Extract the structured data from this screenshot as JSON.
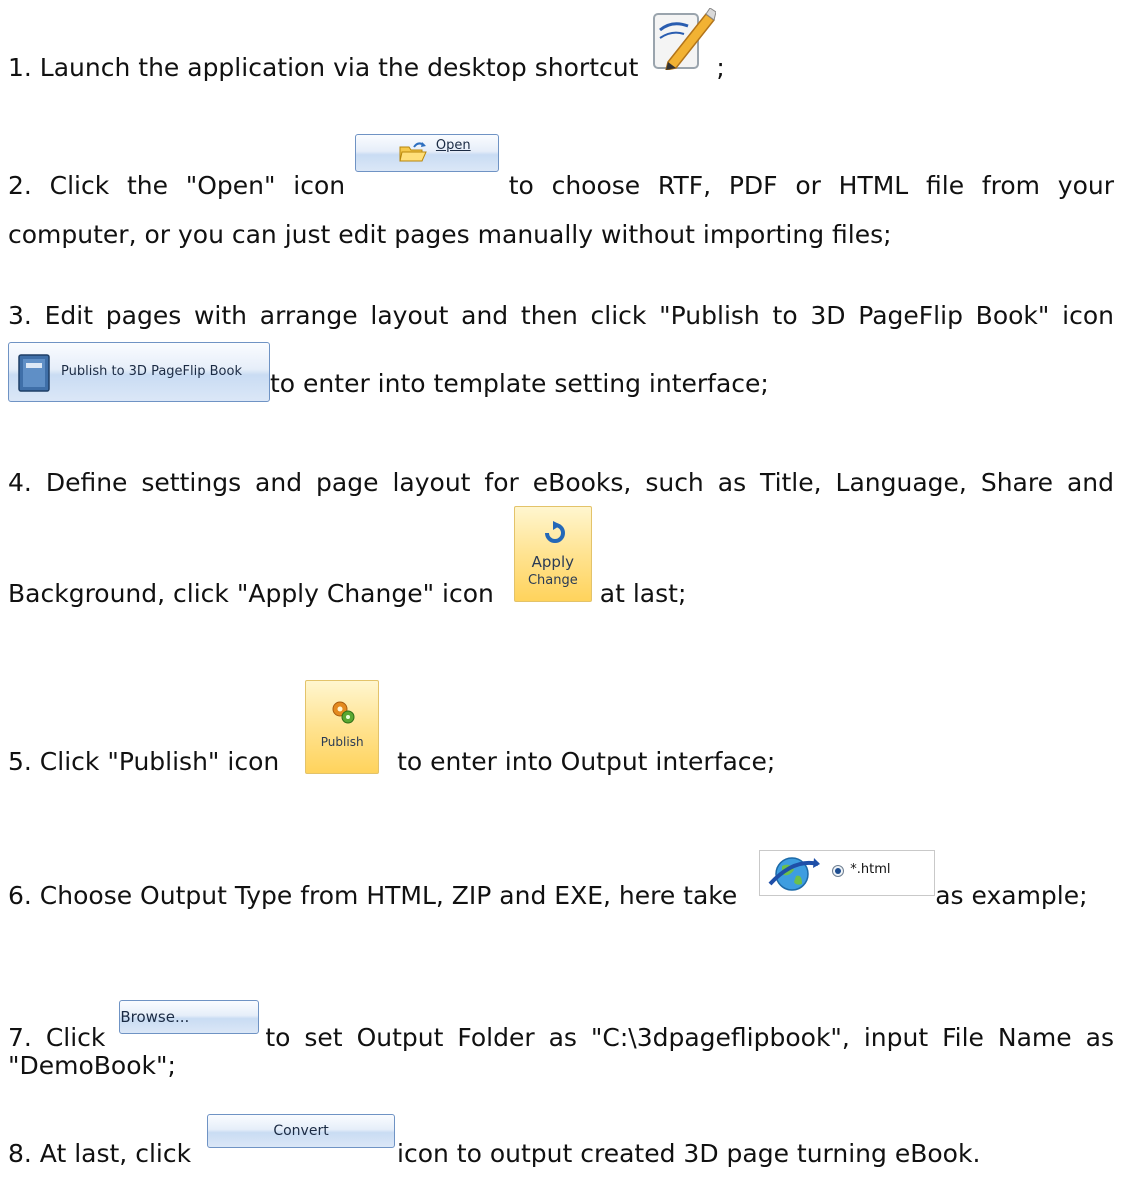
{
  "steps": [
    {
      "text": "1. Launch the application via the desktop shortcut",
      "after": ";",
      "icon": "desktop-shortcut-icon"
    },
    {
      "before": "2. Click the \"Open\" icon",
      "button_label": "Open",
      "after": "to choose RTF, PDF or HTML file from your",
      "line2": "computer, or you can just edit pages manually without importing files;"
    },
    {
      "line1": "3. Edit pages with arrange layout and then click \"Publish to 3D PageFlip Book\" icon",
      "button_label": "Publish to 3D PageFlip Book",
      "after": "to enter into template setting interface;"
    },
    {
      "line1": "4. Define settings and page layout for eBooks, such as Title, Language, Share and",
      "before": "Background, click \"Apply Change\" icon",
      "button_label_1": "Apply",
      "button_label_2": "Change",
      "after": "at last;"
    },
    {
      "before": "5. Click \"Publish\" icon",
      "button_label": "Publish",
      "after": "to enter into Output interface;"
    },
    {
      "before": "6. Choose Output Type from HTML, ZIP and EXE, here take",
      "option_label": "*.html",
      "after": "as example;"
    },
    {
      "before": "7. Click",
      "button_label": "Browse...",
      "after": "to set Output Folder as \"C:\\3dpageflipbook\", input File Name as",
      "line2": "\"DemoBook\";"
    },
    {
      "before": "8. At last, click",
      "button_label": "Convert",
      "after": "icon to output created 3D page turning eBook."
    }
  ],
  "colors": {
    "text": "#111111",
    "blue_button_border": "#6f93c4",
    "yellow_button_border": "#e3c36a"
  }
}
